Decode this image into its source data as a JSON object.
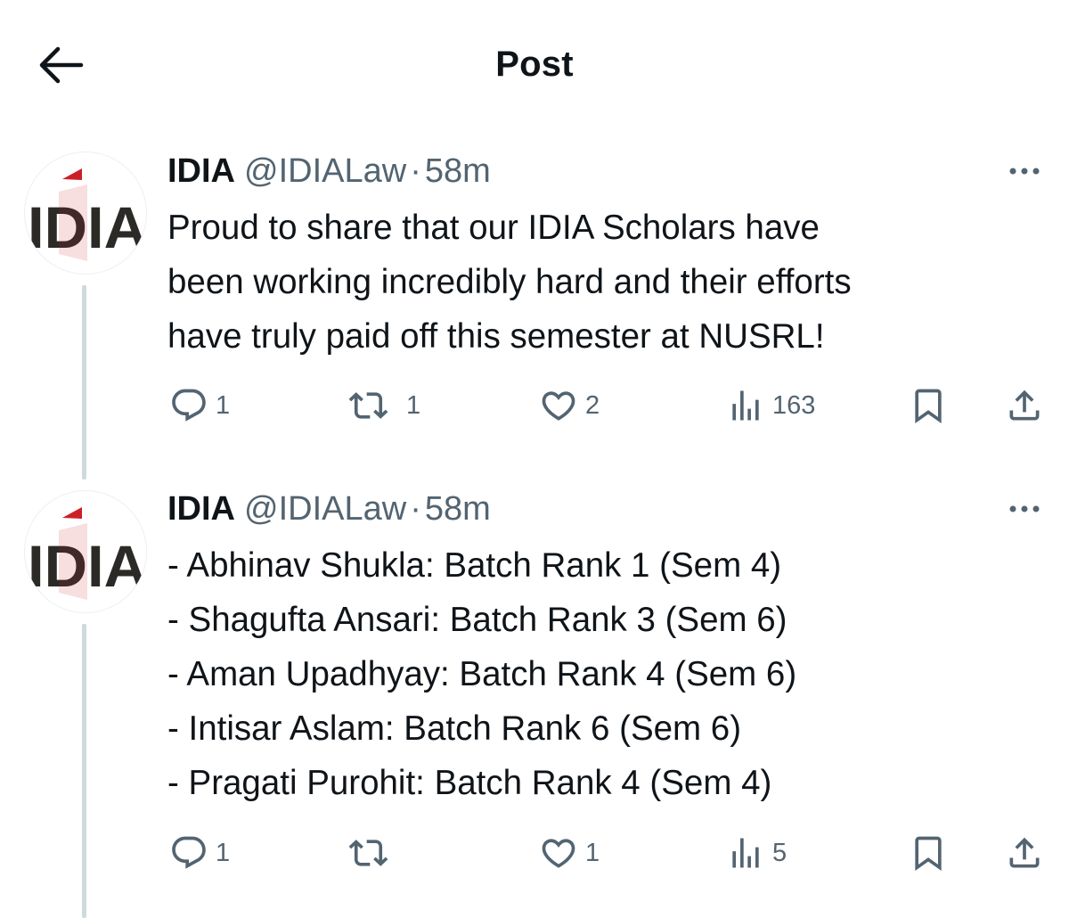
{
  "header": {
    "title": "Post",
    "back_icon": "arrow-left-icon"
  },
  "colors": {
    "text_primary": "#0f1419",
    "text_secondary": "#536471",
    "thread_line": "#cfd9de",
    "logo_red": "#cc2027",
    "logo_dark": "#2b2a26"
  },
  "tweets": [
    {
      "author": {
        "avatar_logo_text": "IDIA",
        "name": "IDIA",
        "handle": "@IDIALaw",
        "separator": "·",
        "time": "58m"
      },
      "lines": [
        "Proud to share that our IDIA Scholars have",
        "been working incredibly hard and their efforts",
        "have truly paid off this semester at NUSRL!"
      ],
      "actions": {
        "replies": "1",
        "reposts": "1",
        "likes": "2",
        "views": "163"
      }
    },
    {
      "author": {
        "avatar_logo_text": "IDIA",
        "name": "IDIA",
        "handle": "@IDIALaw",
        "separator": "·",
        "time": "58m"
      },
      "lines": [
        "- Abhinav Shukla: Batch Rank 1 (Sem 4)",
        "- Shagufta Ansari: Batch Rank 3 (Sem 6)",
        "- Aman Upadhyay: Batch Rank 4 (Sem 6)",
        "- Intisar Aslam: Batch Rank 6 (Sem 6)",
        "- Pragati Purohit: Batch Rank 4 (Sem 4)"
      ],
      "actions": {
        "replies": "1",
        "reposts": "",
        "likes": "1",
        "views": "5"
      }
    }
  ],
  "icons": {
    "more": "more-horizontal-icon",
    "reply": "reply-icon",
    "repost": "repost-icon",
    "like": "heart-icon",
    "views": "views-chart-icon",
    "bookmark": "bookmark-icon",
    "share": "share-icon"
  }
}
